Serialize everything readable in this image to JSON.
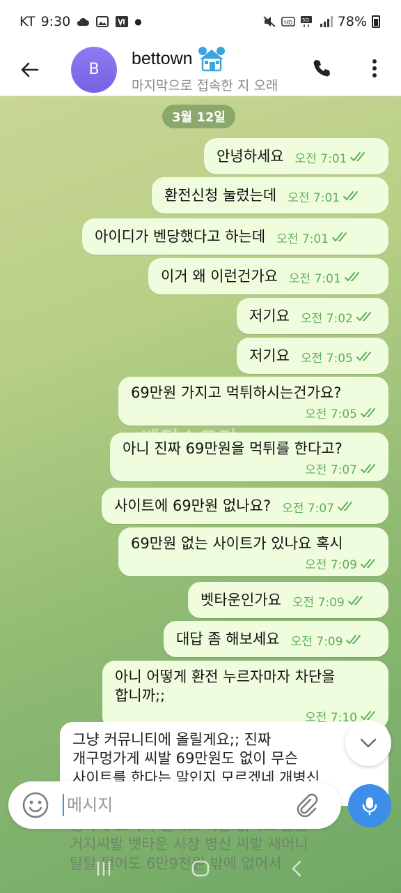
{
  "status_bar": {
    "carrier": "KT",
    "time": "9:30",
    "battery": "78%"
  },
  "header": {
    "avatar_letter": "B",
    "name": "bettown",
    "status": "마지막으로 접속한 지 오래"
  },
  "date_separator": "3월 12일",
  "watermark": "베팅스토리",
  "messages": [
    {
      "text": "안녕하세요",
      "time": "오전 7:01"
    },
    {
      "text": "환전신청 눌렀는데",
      "time": "오전 7:01"
    },
    {
      "text": "아이디가 벤당했다고 하는데",
      "time": "오전 7:01"
    },
    {
      "text": "이거 왜 이런건가요",
      "time": "오전 7:01"
    },
    {
      "text": "저기요",
      "time": "오전 7:02"
    },
    {
      "text": "저기요",
      "time": "오전 7:05"
    },
    {
      "text": "69만원 가지고 먹튀하시는건가요?",
      "time": "오전 7:05"
    },
    {
      "text": "아니 진짜 69만원을 먹튀를 한다고?",
      "time": "오전 7:07"
    },
    {
      "text": "사이트에 69만원 없나요?",
      "time": "오전 7:07"
    },
    {
      "text": "69만원 없는 사이트가 있나요 혹시",
      "time": "오전 7:09"
    },
    {
      "text": "벳타운인가요",
      "time": "오전 7:09"
    },
    {
      "text": "대답 좀 해보세요",
      "time": "오전 7:09"
    },
    {
      "text": "아니 어떻게 환전 누르자마자 차단을\n합니까;;",
      "time": "오전 7:10"
    }
  ],
  "draft_message": {
    "text": "그냥 커뮤니티에 올릴게요;; 진짜\n개구멍가게 씨발 69만원도 없이 무슨\n사이트를 한다는 말인지 모르겠네 개병신"
  },
  "behind_input_text": "생각에 쪼려서 텔레도 씨발 읽지도 않는\n거지씨발 벳타운 시장 병신 씨발 새머니\n탈탈 털어도 6만9천원 밖에 없어서",
  "input": {
    "placeholder": "메시지"
  }
}
